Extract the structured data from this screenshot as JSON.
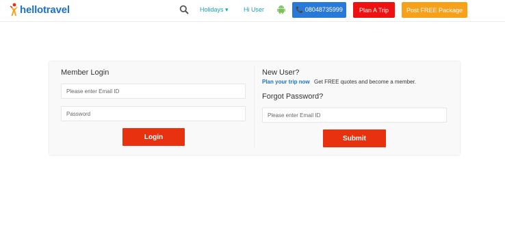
{
  "header": {
    "brand": "hellotravel",
    "nav": {
      "holidays": "Holidays ▾",
      "hi_user": "Hi User"
    },
    "phone_button": "📞 08048735999",
    "plan_trip_button": "Plan A Trip",
    "post_package_button": "Post FREE Package",
    "icons": [
      "search-icon",
      "android-icon",
      "phone-icon"
    ]
  },
  "member_login": {
    "title": "Member Login",
    "email_placeholder": "Please enter Email ID",
    "password_placeholder": "Password",
    "login_button": "Login"
  },
  "new_user": {
    "title": "New User?",
    "plan_link": "Plan your trip now",
    "description": "Get FREE quotes and become a member."
  },
  "forgot_password": {
    "title": "Forgot Password?",
    "email_placeholder": "Please enter Email ID",
    "submit_button": "Submit"
  },
  "colors": {
    "accent_red": "#e8320f",
    "phone_blue": "#2979d9",
    "plan_red": "#ee1111",
    "post_orange": "#f7a11a",
    "nav_teal": "#1aa3b8",
    "link_blue": "#1a73c8"
  }
}
